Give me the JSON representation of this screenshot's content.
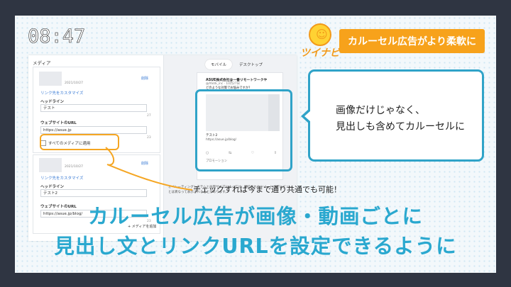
{
  "clock": "08:47",
  "logo": {
    "text": "ツイナビ",
    "icon": "smiley-sun-icon"
  },
  "badge": "カルーセル広告がより柔軟に",
  "editor": {
    "section_title": "メディア",
    "cards": [
      {
        "date": "2021/10/27",
        "delete": "削除",
        "customize_link": "リンク先をカスタマイズ",
        "headline_label": "ヘッドライン",
        "headline_value": "テスト",
        "headline_count": "27",
        "url_label": "ウェブサイトのURL",
        "url_value": "https://asue.jp",
        "url_count": "23",
        "apply_all": "すべてのメディアに適用"
      },
      {
        "date": "2021/10/27",
        "delete": "削除",
        "customize_link": "リンク先をカスタマイズ",
        "headline_label": "ヘッドライン",
        "headline_value": "テスト2",
        "headline_count": "",
        "url_label": "ウェブサイトのURL",
        "url_value": "https://asue.jp/blog/",
        "url_count": "23"
      }
    ],
    "add_media": "+ メディアを追加"
  },
  "preview": {
    "tabs": [
      "モバイル",
      "デスクトップ"
    ],
    "active_tab": "モバイル",
    "tweet": {
      "name": "ASUE株式会社@一番リモートワークや",
      "sub": "@ASUE_inc · 10月27日",
      "body": "どのような対策でお悩みですか?",
      "card_title": "テスト2",
      "card_url": "https://asue.jp/blog/",
      "actions": [
        "○",
        "⇆",
        "♡",
        "⇧"
      ],
      "promo": "プロモーション"
    },
    "note": "オペレーティングシステムと画面サイズによっては、配信されたツイートがプレビューとは異なって表示されることがあります。"
  },
  "bubble_lines": [
    "画像だけじゃなく、",
    "見出しも含めてカルーセルに"
  ],
  "callout_note": "チェックすれば今まで通り共通でも可能！",
  "headline_lines": [
    "カルーセル広告が画像・動画ごとに",
    "見出し文とリンクURLを設定できるように"
  ],
  "colors": {
    "accent_blue": "#2aa8cf",
    "accent_orange": "#f7a21b",
    "frame": "#2f3542"
  }
}
